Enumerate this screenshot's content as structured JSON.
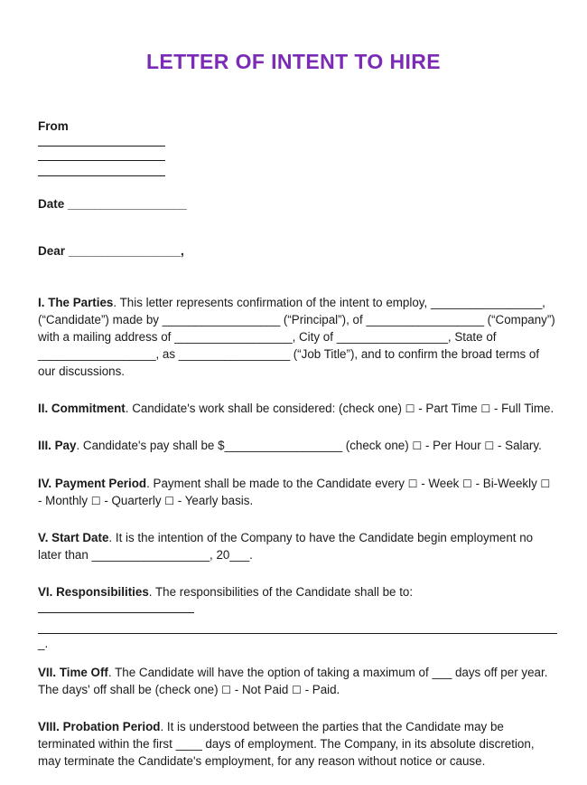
{
  "document": {
    "title": "LETTER OF INTENT TO HIRE",
    "title_color": "#7b2bb5"
  },
  "header_block": {
    "from_label": "From",
    "from_blank_line_count": 3,
    "date_label": "Date",
    "date_blank": "__________________",
    "salutation_label": "Dear",
    "salutation_blank": "_________________,"
  },
  "sections": {
    "parties": {
      "number": "I.",
      "heading": "The Parties",
      "text_1": ". This letter represents confirmation of the intent to employ,",
      "blank_candidate": "_________________",
      "text_2": ", (“Candidate”) made by",
      "blank_principal": "__________________",
      "text_3": "(“Principal”), of",
      "blank_company": "__________________",
      "text_4": "(“Company”) with a mailing address of",
      "blank_address": "__________________",
      "text_5": ", City of",
      "blank_city": "_________________",
      "text_6": ", State of",
      "blank_state": "__________________",
      "text_7": ", as",
      "blank_jobtitle": "_________________",
      "text_8": "(“Job Title”), and to confirm the broad terms of our discussions."
    },
    "commitment": {
      "number": "II.",
      "heading": "Commitment",
      "text_1": ". Candidate's work shall be considered: (check one)",
      "checkbox": "☐",
      "option_1": "- Part Time",
      "option_2": "- Full Time."
    },
    "pay": {
      "number": "III.",
      "heading": "Pay",
      "text_1": ". Candidate's pay shall be $",
      "blank_amount": "__________________",
      "text_2": "(check one)",
      "checkbox": "☐",
      "option_1": "- Per Hour",
      "option_2": "- Salary."
    },
    "payment_period": {
      "number": "IV.",
      "heading": "Payment Period",
      "text_1": ". Payment shall be made to the Candidate every",
      "checkbox": "☐",
      "option_1": "- Week",
      "option_2": "- Bi-Weekly",
      "option_3": "- Monthly",
      "option_4": "- Quarterly",
      "option_5": "- Yearly basis."
    },
    "start_date": {
      "number": "V.",
      "heading": "Start Date",
      "text_1": ". It is the intention of the Company to have the Candidate begin employment no later than",
      "blank_date": "__________________",
      "text_2": ", 20",
      "blank_year": "___",
      "text_3": "."
    },
    "responsibilities": {
      "number": "VI.",
      "heading": "Responsibilities",
      "text_1": ". The responsibilities of the Candidate shall be to:",
      "answer_line_short": true,
      "answer_line_long": true,
      "trailing_fragment": "_."
    },
    "time_off": {
      "number": "VII.",
      "heading": "Time Off",
      "text_1": ". The Candidate will have the option of taking a maximum of",
      "blank_days": "___",
      "text_2": "days off per year. The days' off shall be (check one)",
      "checkbox": "☐",
      "option_1": "- Not Paid",
      "option_2": "- Paid."
    },
    "probation": {
      "number": "VIII.",
      "heading": "Probation Period",
      "text_1": ". It is understood between the parties that the Candidate may be terminated within the first",
      "blank_days": "____",
      "text_2": "days of employment. The Company, in its absolute discretion, may terminate the Candidate's employment, for any reason without notice or cause."
    }
  }
}
